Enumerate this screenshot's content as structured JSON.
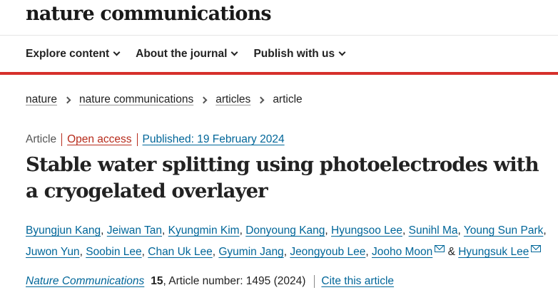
{
  "header": {
    "logo_text": "nature communications"
  },
  "nav": {
    "items": [
      {
        "label": "Explore content"
      },
      {
        "label": "About the journal"
      },
      {
        "label": "Publish with us"
      }
    ],
    "accent_color": "#d6302b"
  },
  "breadcrumb": {
    "items": [
      "nature",
      "nature communications",
      "articles"
    ],
    "current": "article"
  },
  "article_meta": {
    "type": "Article",
    "access": "Open access",
    "published": "Published: 19 February 2024"
  },
  "article": {
    "title": "Stable water splitting using photoelectrodes with a cryogelated overlayer"
  },
  "authors": [
    "Byungjun Kang",
    "Jeiwan Tan",
    "Kyungmin Kim",
    "Donyoung Kang",
    "Hyungsoo Lee",
    "Sunihl Ma",
    "Young Sun Park",
    "Juwon Yun",
    "Soobin Lee",
    "Chan Uk Lee",
    "Gyumin Jang",
    "Jeongyoub Lee",
    "Jooho Moon",
    "Hyungsuk Lee"
  ],
  "authors_separator": ",",
  "authors_and": "&",
  "citation": {
    "journal": "Nature Communications",
    "volume": "15",
    "article_number": ", Article number: 1495 (2024)",
    "cite_label": "Cite this article"
  },
  "colors": {
    "link": "#006699",
    "open_access": "#b72b1b"
  }
}
